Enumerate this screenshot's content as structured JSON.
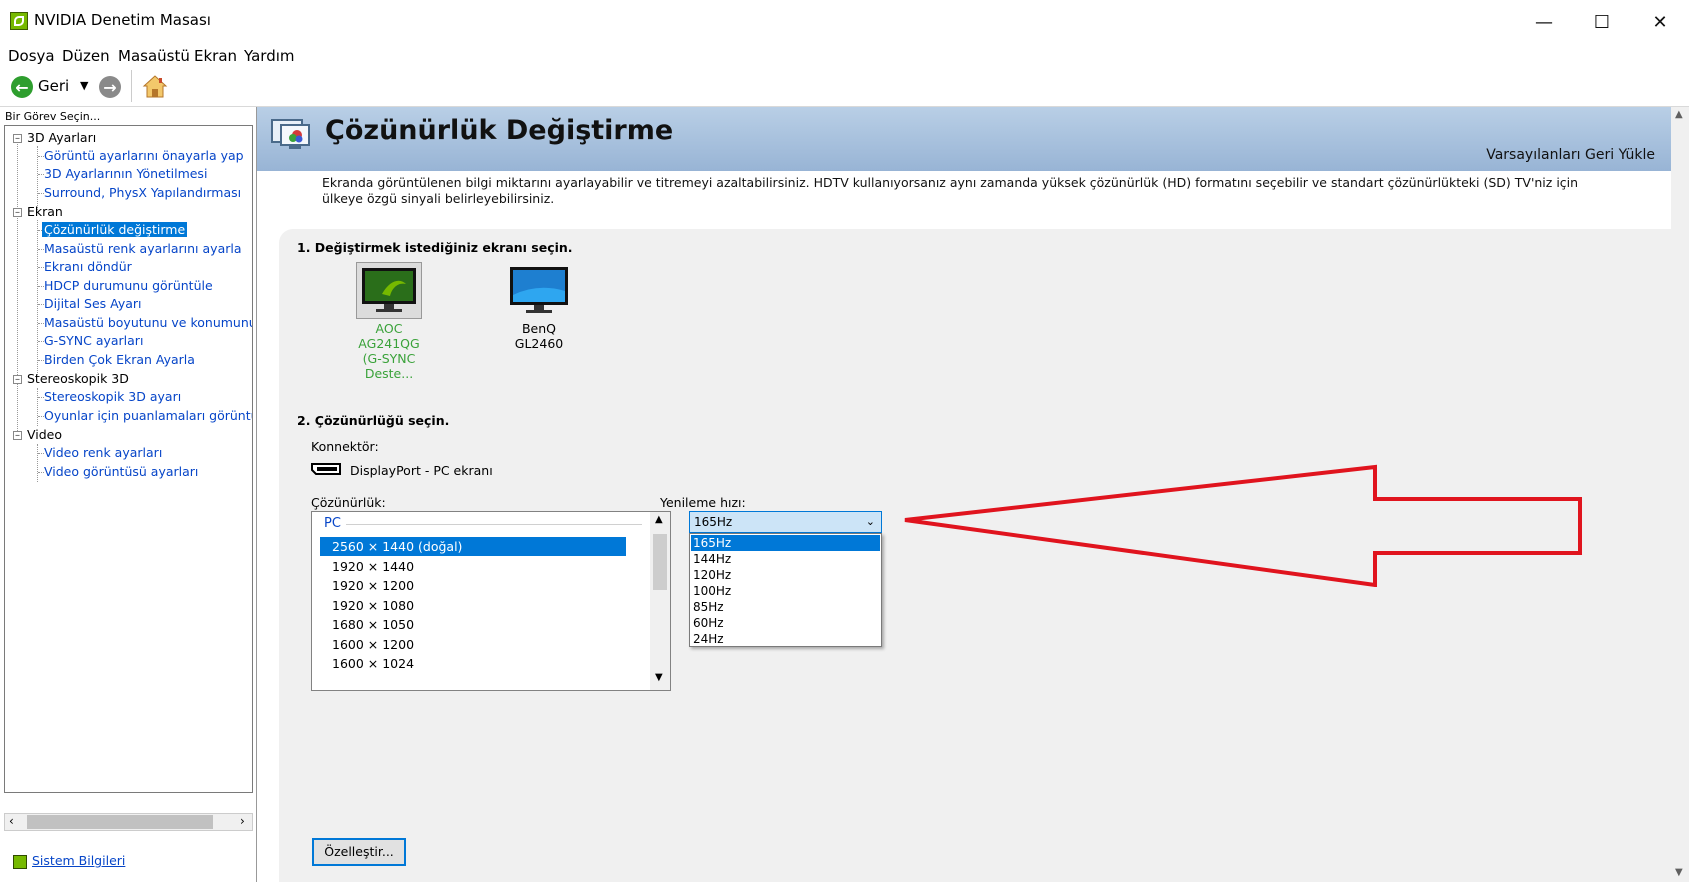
{
  "window": {
    "title": "NVIDIA Denetim Masası"
  },
  "menu": [
    "Dosya",
    "Düzen",
    "Masaüstü",
    "Ekran",
    "Yardım"
  ],
  "toolbar": {
    "back_label": "Geri"
  },
  "left_panel": {
    "task_label": "Bir Görev Seçin...",
    "categories": [
      {
        "label": "3D Ayarları",
        "items": [
          "Görüntü ayarlarını önayarla yap",
          "3D Ayarlarının Yönetilmesi",
          "Surround, PhysX Yapılandırması"
        ]
      },
      {
        "label": "Ekran",
        "items": [
          "Çözünürlük değiştirme",
          "Masaüstü renk ayarlarını ayarla",
          "Ekranı döndür",
          "HDCP durumunu görüntüle",
          "Dijital Ses Ayarı",
          "Masaüstü boyutunu ve konumunu ay",
          "G-SYNC ayarları",
          "Birden Çok Ekran Ayarla"
        ]
      },
      {
        "label": "Stereoskopik 3D",
        "items": [
          "Stereoskopik 3D ayarı",
          "Oyunlar için puanlamaları görüntüle"
        ]
      },
      {
        "label": "Video",
        "items": [
          "Video renk ayarları",
          "Video görüntüsü ayarları"
        ]
      }
    ],
    "selected_item": "Çözünürlük değiştirme",
    "system_info": "Sistem Bilgileri"
  },
  "page": {
    "title": "Çözünürlük Değiştirme",
    "restore_defaults": "Varsayılanları Geri Yükle",
    "description": "Ekranda görüntülenen bilgi miktarını ayarlayabilir ve titremeyi azaltabilirsiniz. HDTV kullanıyorsanız aynı zamanda yüksek çözünürlük (HD) formatını seçebilir ve standart çözünürlükteki (SD) TV'niz için ülkeye özgü sinyali belirleyebilirsiniz.",
    "step1": "1. Değiştirmek istediğiniz ekranı seçin.",
    "displays": [
      {
        "name_line1": "AOC AG241QG",
        "name_line2": "(G-SYNC Deste...",
        "selected": true
      },
      {
        "name_line1": "BenQ GL2460",
        "name_line2": "",
        "selected": false
      }
    ],
    "step2": "2. Çözünürlüğü seçin.",
    "connector_label": "Konnektör:",
    "connector_value": "DisplayPort - PC ekranı",
    "resolution_label": "Çözünürlük:",
    "resolution_group": "PC",
    "resolutions": [
      "2560 × 1440 (doğal)",
      "1920 × 1440",
      "1920 × 1200",
      "1920 × 1080",
      "1680 × 1050",
      "1600 × 1200",
      "1600 × 1024"
    ],
    "selected_resolution": "2560 × 1440 (doğal)",
    "refresh_label": "Yenileme hızı:",
    "refresh_selected": "165Hz",
    "refresh_options": [
      "165Hz",
      "144Hz",
      "120Hz",
      "100Hz",
      "85Hz",
      "60Hz",
      "24Hz"
    ],
    "customize_button": "Özelleştir..."
  },
  "colors": {
    "accent": "#0078d7",
    "link": "#0645c8",
    "nvidia_green": "#76b900",
    "arrow": "#e0141e",
    "banner": "#a9c2e0"
  }
}
